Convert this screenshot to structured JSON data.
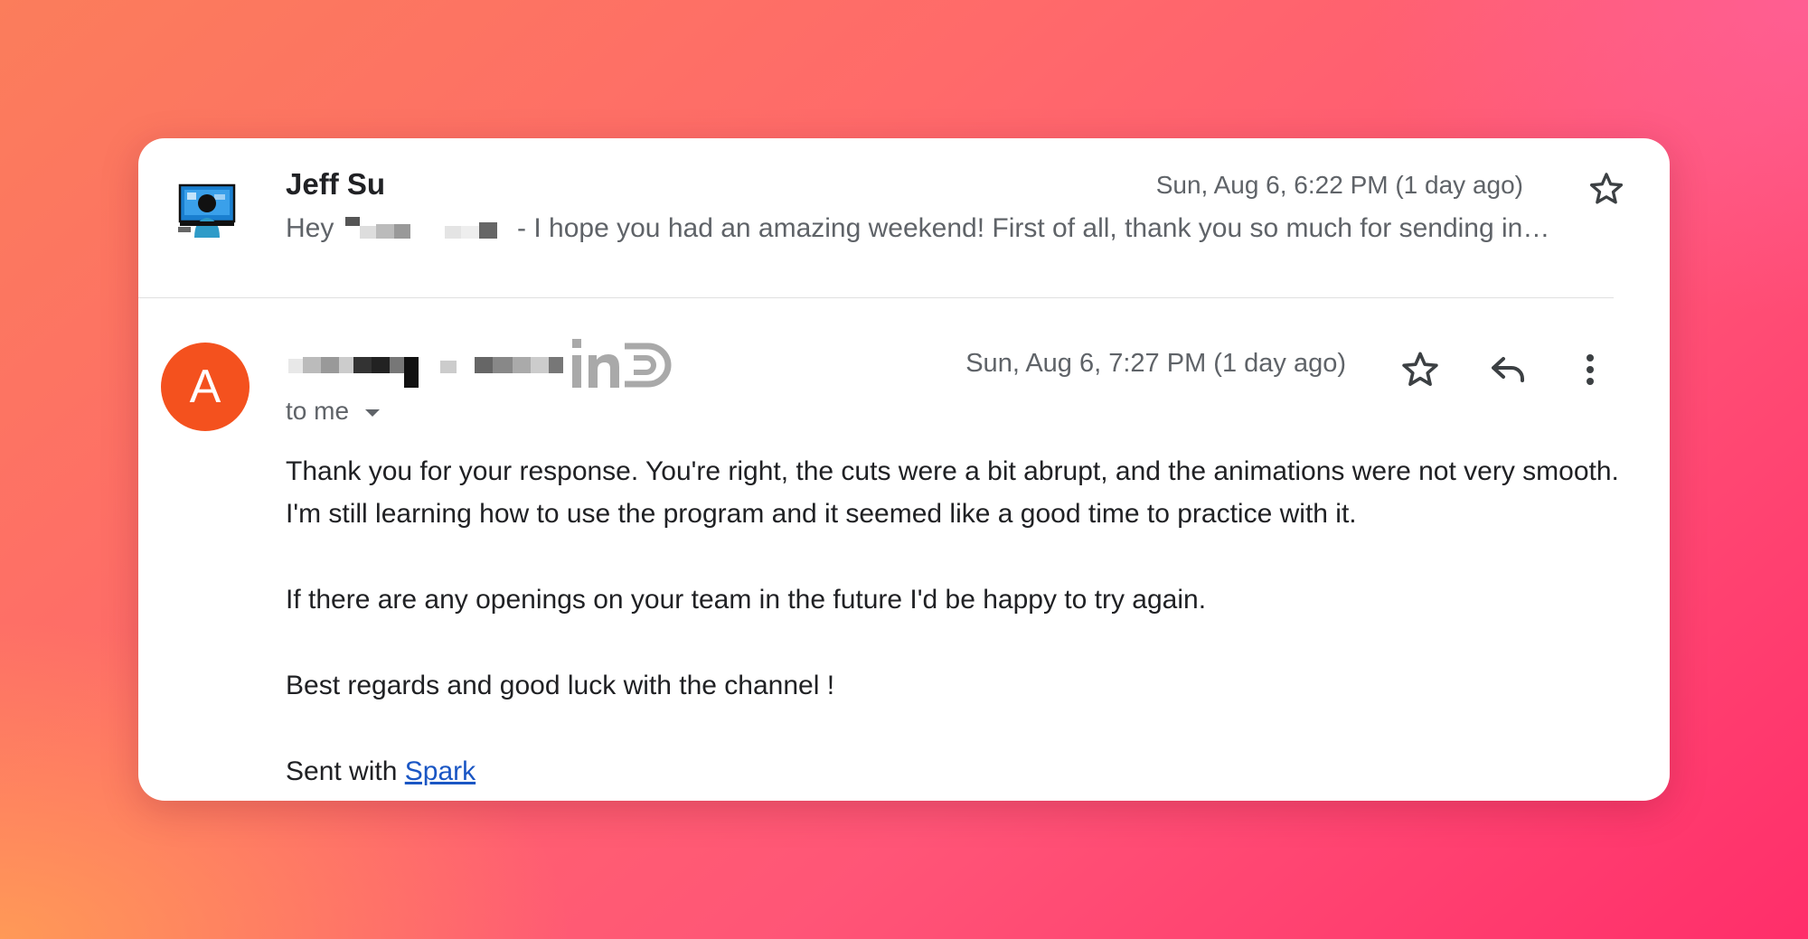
{
  "messages": [
    {
      "sender": "Jeff Su",
      "date": "Sun, Aug 6, 6:22 PM (1 day ago)",
      "snippet_start": "Hey",
      "snippet_rest": "- I hope you had an amazing weekend! First of all, thank you so much for sending in…"
    },
    {
      "avatar_letter": "A",
      "avatar_color": "#f4511e",
      "date": "Sun, Aug 6, 7:27 PM (1 day ago)",
      "recipient": "to me",
      "body": {
        "p1": "Thank you for your response. You're right, the cuts were a bit abrupt, and the animations were not very smooth. I'm still learning how to use the program and it seemed like a good time to practice with it.",
        "p2": "If there are any openings on your team in the future I'd be happy to try again.",
        "p3": "Best regards and good luck with the channel !",
        "signature_prefix": "Sent with",
        "signature_link": "Spark"
      },
      "badges": [
        "linkedin-icon",
        "d-logo-icon"
      ]
    }
  ],
  "icons": [
    "star-icon",
    "reply-icon",
    "more-vert-icon",
    "chevron-down-icon"
  ],
  "colors": {
    "link": "#1a56c4",
    "avatar": "#f4511e",
    "muted_text": "#5f6368",
    "text": "#202124"
  }
}
